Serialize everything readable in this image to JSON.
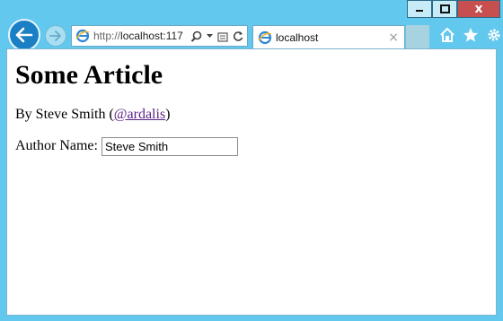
{
  "window": {
    "minimize_icon": "minimize-icon",
    "maximize_icon": "maximize-icon",
    "close_label": "x"
  },
  "nav": {
    "back_icon": "back-arrow-icon",
    "forward_icon": "forward-arrow-icon"
  },
  "address_bar": {
    "scheme": "http://",
    "host": "localhost:117"
  },
  "tab": {
    "label": "localhost",
    "close": "×"
  },
  "toolbar_icons": [
    "home-icon",
    "favorites-star-icon",
    "settings-gear-icon"
  ],
  "page": {
    "title": "Some Article",
    "byline_prefix": "By Steve Smith (",
    "byline_link": "@ardalis",
    "byline_suffix": ")",
    "author_label": "Author Name:",
    "author_value": "Steve Smith"
  },
  "colors": {
    "chrome": "#62c8ee",
    "close_button": "#c74f4f",
    "link": "#5a1f84"
  }
}
